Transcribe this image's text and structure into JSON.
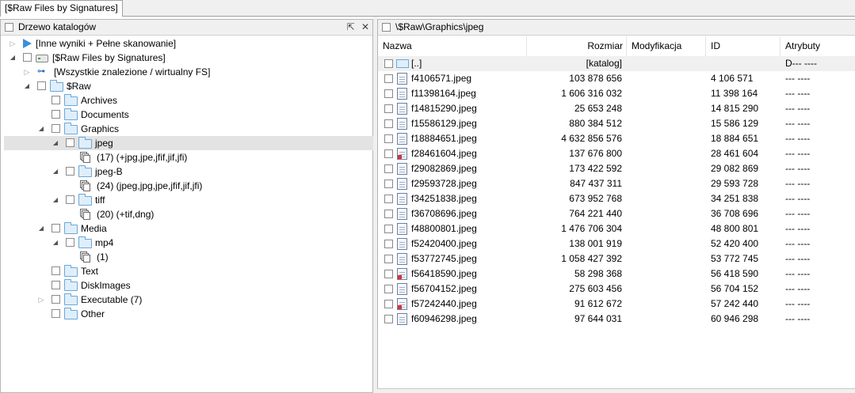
{
  "tabs": [
    "[$Raw Files by Signatures]"
  ],
  "left_panel": {
    "title": "Drzewo katalogów",
    "pin_icon": "pin-icon",
    "close_icon": "close-icon",
    "tree": [
      {
        "label": "[Inne wyniki + Pełne skanowanie]",
        "icon": "play-icon",
        "level": 0,
        "toggle": "collapsed",
        "checkbox": false
      },
      {
        "label": "[$Raw Files by Signatures]",
        "icon": "drive-icon",
        "level": 0,
        "toggle": "expanded",
        "checkbox": true
      },
      {
        "label": "[Wszystkie znalezione / wirtualny FS]",
        "icon": "network-icon",
        "level": 1,
        "toggle": "collapsed",
        "checkbox": false
      },
      {
        "label": "$Raw",
        "icon": "folder-icon",
        "level": 1,
        "toggle": "expanded",
        "checkbox": true
      },
      {
        "label": "Archives",
        "icon": "folder-icon",
        "level": 2,
        "toggle": "",
        "checkbox": true
      },
      {
        "label": "Documents",
        "icon": "folder-icon",
        "level": 2,
        "toggle": "",
        "checkbox": true
      },
      {
        "label": "Graphics",
        "icon": "folder-icon",
        "level": 2,
        "toggle": "expanded",
        "checkbox": true
      },
      {
        "label": "jpeg",
        "icon": "folder-icon",
        "level": 3,
        "toggle": "expanded",
        "checkbox": true,
        "selected": true
      },
      {
        "label": "(17) (+jpg,jpe,jfif,jif,jfi)",
        "icon": "pages-icon",
        "level": 4,
        "toggle": "",
        "checkbox": false
      },
      {
        "label": "jpeg-B",
        "icon": "folder-icon",
        "level": 3,
        "toggle": "expanded",
        "checkbox": true
      },
      {
        "label": "(24) (jpeg,jpg,jpe,jfif,jif,jfi)",
        "icon": "pages-icon",
        "level": 4,
        "toggle": "",
        "checkbox": false
      },
      {
        "label": "tiff",
        "icon": "folder-icon",
        "level": 3,
        "toggle": "expanded",
        "checkbox": true
      },
      {
        "label": "(20) (+tif,dng)",
        "icon": "pages-icon",
        "level": 4,
        "toggle": "",
        "checkbox": false
      },
      {
        "label": "Media",
        "icon": "folder-icon",
        "level": 2,
        "toggle": "expanded",
        "checkbox": true
      },
      {
        "label": "mp4",
        "icon": "folder-icon",
        "level": 3,
        "toggle": "expanded",
        "checkbox": true
      },
      {
        "label": "(1)",
        "icon": "pages-icon",
        "level": 4,
        "toggle": "",
        "checkbox": false
      },
      {
        "label": "Text",
        "icon": "folder-icon",
        "level": 2,
        "toggle": "",
        "checkbox": true
      },
      {
        "label": "DiskImages",
        "icon": "folder-icon",
        "level": 2,
        "toggle": "",
        "checkbox": true
      },
      {
        "label": "Executable (7)",
        "icon": "folder-icon",
        "level": 2,
        "toggle": "collapsed",
        "checkbox": true
      },
      {
        "label": "Other",
        "icon": "folder-icon",
        "level": 2,
        "toggle": "",
        "checkbox": true
      }
    ]
  },
  "right_panel": {
    "path": "\\$Raw\\Graphics\\jpeg",
    "columns": [
      "Nazwa",
      "Rozmiar",
      "Modyfikacja",
      "ID",
      "Atrybuty"
    ],
    "parent_row": {
      "name": "[..]",
      "size": "[katalog]",
      "attr": "D--- ----"
    },
    "files": [
      {
        "name": "f4106571.jpeg",
        "size": "103 878 656",
        "id": "4 106 571",
        "attr": "--- ----",
        "bad": false
      },
      {
        "name": "f11398164.jpeg",
        "size": "1 606 316 032",
        "id": "11 398 164",
        "attr": "--- ----",
        "bad": false
      },
      {
        "name": "f14815290.jpeg",
        "size": "25 653 248",
        "id": "14 815 290",
        "attr": "--- ----",
        "bad": false
      },
      {
        "name": "f15586129.jpeg",
        "size": "880 384 512",
        "id": "15 586 129",
        "attr": "--- ----",
        "bad": false
      },
      {
        "name": "f18884651.jpeg",
        "size": "4 632 856 576",
        "id": "18 884 651",
        "attr": "--- ----",
        "bad": false
      },
      {
        "name": "f28461604.jpeg",
        "size": "137 676 800",
        "id": "28 461 604",
        "attr": "--- ----",
        "bad": true
      },
      {
        "name": "f29082869.jpeg",
        "size": "173 422 592",
        "id": "29 082 869",
        "attr": "--- ----",
        "bad": false
      },
      {
        "name": "f29593728.jpeg",
        "size": "847 437 311",
        "id": "29 593 728",
        "attr": "--- ----",
        "bad": false
      },
      {
        "name": "f34251838.jpeg",
        "size": "673 952 768",
        "id": "34 251 838",
        "attr": "--- ----",
        "bad": false
      },
      {
        "name": "f36708696.jpeg",
        "size": "764 221 440",
        "id": "36 708 696",
        "attr": "--- ----",
        "bad": false
      },
      {
        "name": "f48800801.jpeg",
        "size": "1 476 706 304",
        "id": "48 800 801",
        "attr": "--- ----",
        "bad": false
      },
      {
        "name": "f52420400.jpeg",
        "size": "138 001 919",
        "id": "52 420 400",
        "attr": "--- ----",
        "bad": false
      },
      {
        "name": "f53772745.jpeg",
        "size": "1 058 427 392",
        "id": "53 772 745",
        "attr": "--- ----",
        "bad": false
      },
      {
        "name": "f56418590.jpeg",
        "size": "58 298 368",
        "id": "56 418 590",
        "attr": "--- ----",
        "bad": true
      },
      {
        "name": "f56704152.jpeg",
        "size": "275 603 456",
        "id": "56 704 152",
        "attr": "--- ----",
        "bad": false
      },
      {
        "name": "f57242440.jpeg",
        "size": "91 612 672",
        "id": "57 242 440",
        "attr": "--- ----",
        "bad": true
      },
      {
        "name": "f60946298.jpeg",
        "size": "97 644 031",
        "id": "60 946 298",
        "attr": "--- ----",
        "bad": false
      }
    ]
  }
}
